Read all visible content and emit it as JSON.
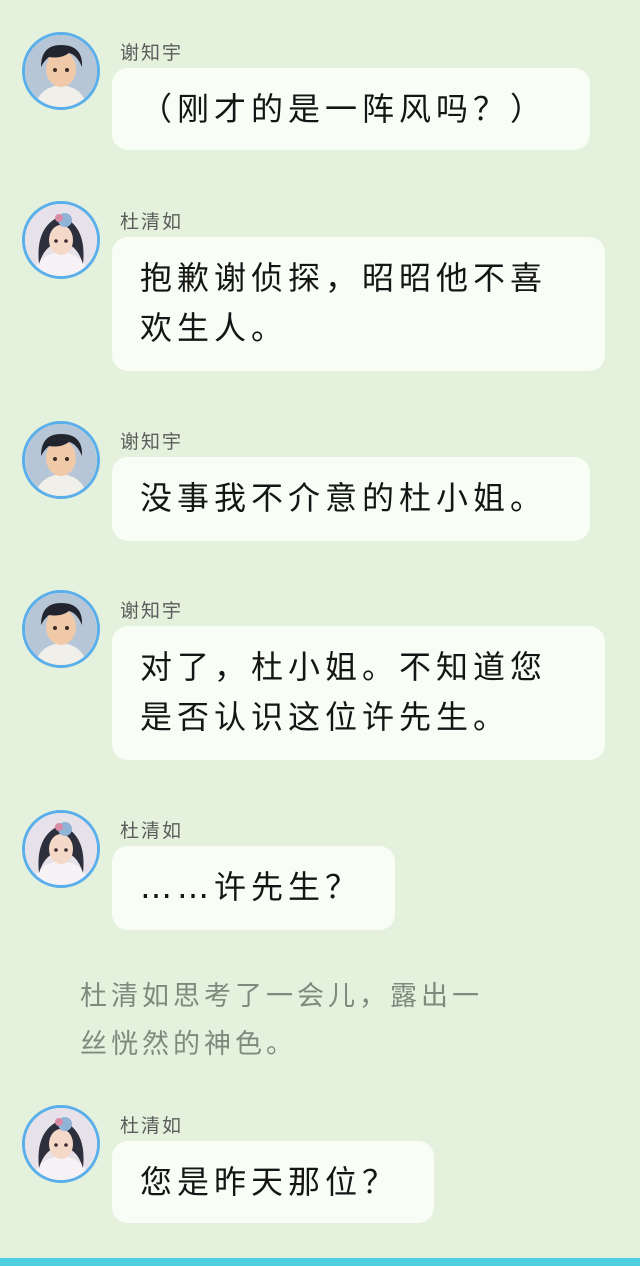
{
  "colors": {
    "background": "#e4f2dd",
    "bubble": "#f8fdf6",
    "avatar_ring": "#5aaeea",
    "bottom_bar": "#4fd0e0",
    "narration_text": "#7f8a7e"
  },
  "messages": [
    {
      "avatar": "xie-zhiyu-avatar",
      "speaker": "谢知宇",
      "text": "（刚才的是一阵风吗？）"
    },
    {
      "avatar": "du-qingru-avatar",
      "speaker": "杜清如",
      "text": "抱歉谢侦探，昭昭他不喜\n欢生人。"
    },
    {
      "avatar": "xie-zhiyu-avatar",
      "speaker": "谢知宇",
      "text": "没事我不介意的杜小姐。"
    },
    {
      "avatar": "xie-zhiyu-avatar",
      "speaker": "谢知宇",
      "text": "对了，杜小姐。不知道您\n是否认识这位许先生。"
    },
    {
      "avatar": "du-qingru-avatar",
      "speaker": "杜清如",
      "text": "……许先生？"
    },
    {
      "avatar": "du-qingru-avatar",
      "speaker": "杜清如",
      "text": "您是昨天那位？"
    }
  ],
  "narration": "杜清如思考了一会儿，露出一\n丝恍然的神色。"
}
